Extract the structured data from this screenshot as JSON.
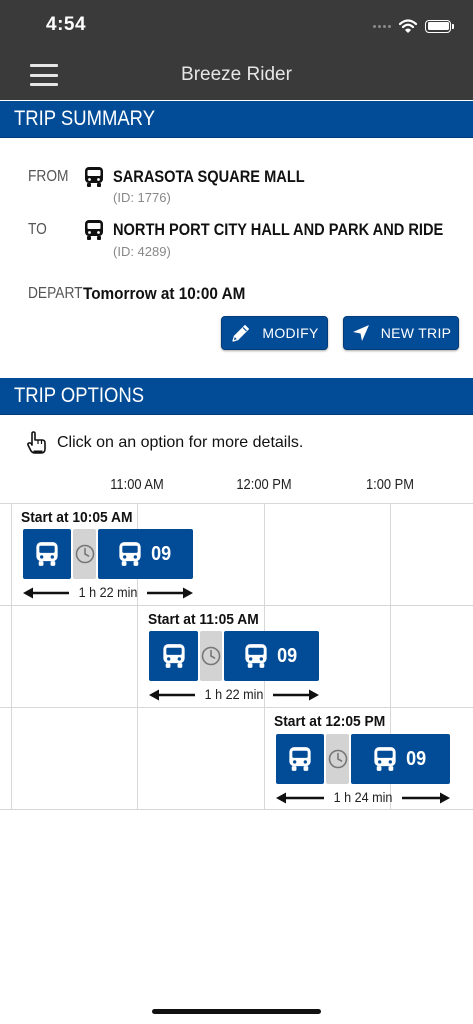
{
  "status_bar": {
    "time": "4:54",
    "icons": [
      "cellular-dots-icon",
      "wifi-icon",
      "battery-icon"
    ]
  },
  "header": {
    "title": "Breeze Rider",
    "menu_icon": "hamburger-menu-icon"
  },
  "trip_summary": {
    "heading": "TRIP SUMMARY",
    "from_label": "FROM",
    "from_name": "SARASOTA SQUARE MALL",
    "from_id": "(ID: 1776)",
    "to_label": "TO",
    "to_name": "NORTH PORT CITY HALL AND PARK AND RIDE",
    "to_id": "(ID: 4289)",
    "depart_label": "DEPART",
    "depart_value": "Tomorrow at 10:00 AM",
    "modify_label": "MODIFY",
    "new_trip_label": "NEW TRIP"
  },
  "trip_options": {
    "heading": "TRIP OPTIONS",
    "hint": "Click on an option for more details.",
    "time_labels": [
      "11:00 AM",
      "12:00 PM",
      "1:00 PM"
    ],
    "options": [
      {
        "start": "Start at 10:05 AM",
        "route": "09",
        "duration": "1 h 22 min"
      },
      {
        "start": "Start at 11:05 AM",
        "route": "09",
        "duration": "1 h 22 min"
      },
      {
        "start": "Start at 12:05 PM",
        "route": "09",
        "duration": "1 h 24 min"
      }
    ]
  },
  "colors": {
    "brand_blue": "#024c97",
    "top_bar": "#3a3a3a",
    "wait_gray": "#d3d3d3"
  }
}
